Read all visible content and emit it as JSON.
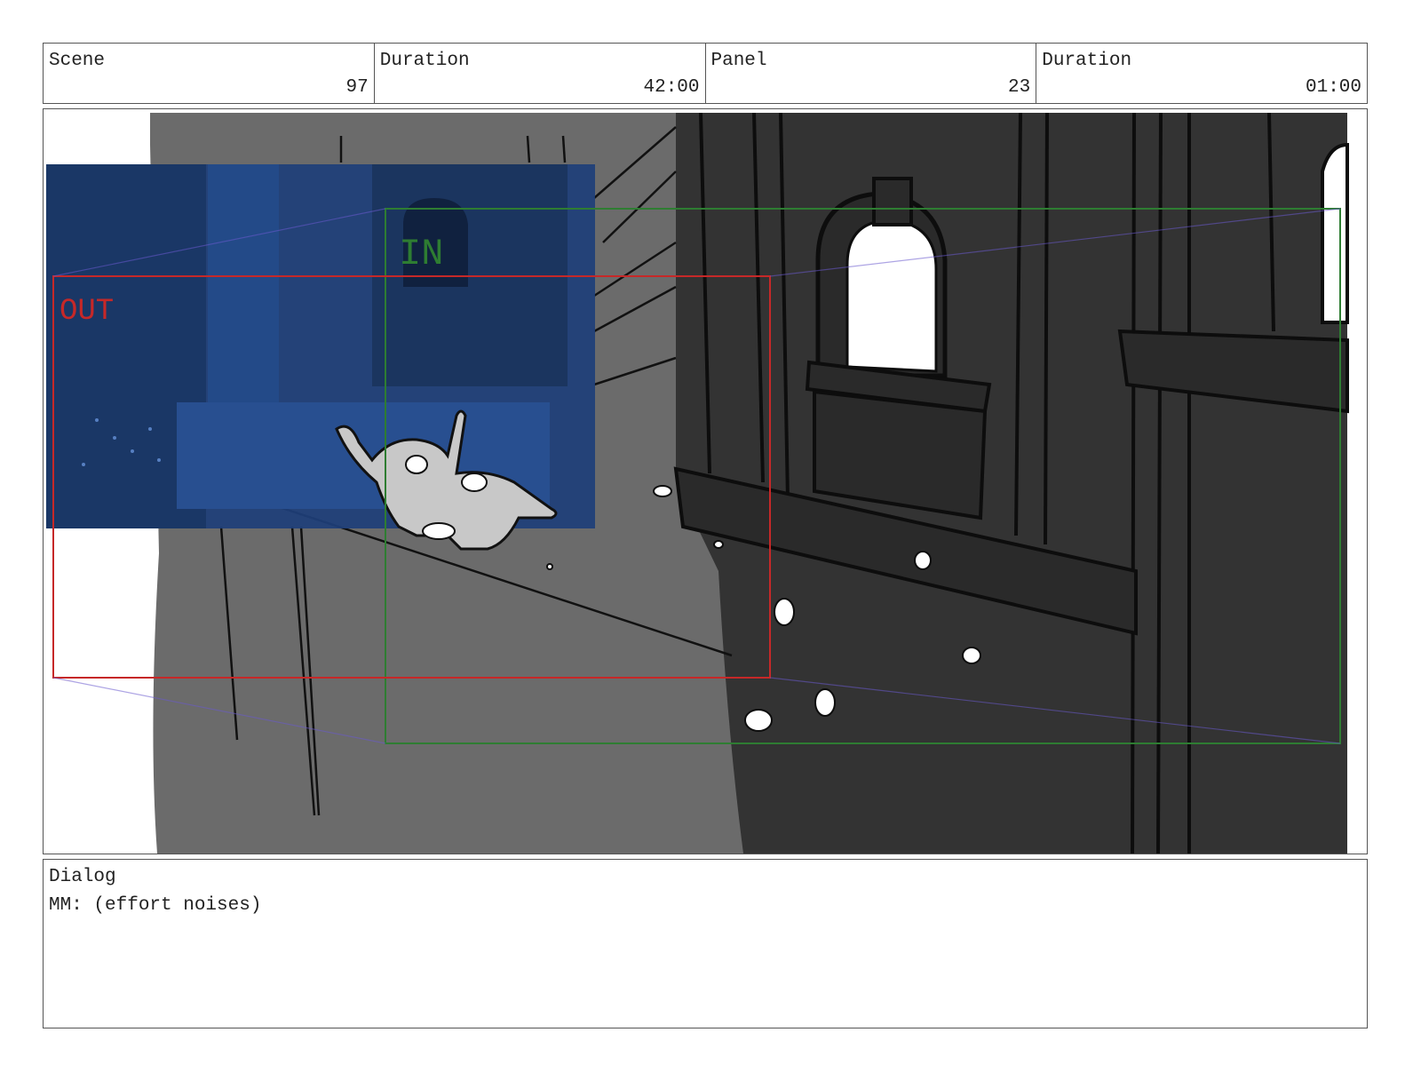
{
  "header": {
    "scene_label": "Scene",
    "scene_value": "97",
    "scene_duration_label": "Duration",
    "scene_duration_value": "42:00",
    "panel_label": "Panel",
    "panel_value": "23",
    "panel_duration_label": "Duration",
    "panel_duration_value": "01:00"
  },
  "panel": {
    "in_frame_label": "IN",
    "out_frame_label": "OUT",
    "colors": {
      "in_frame": "#2e7d32",
      "out_frame": "#c62828",
      "building_dark": "#333333",
      "wall_mid": "#6b6b6b",
      "bg_overlay": "#1e3f7a"
    }
  },
  "dialog": {
    "label": "Dialog",
    "text": "MM: (effort noises)"
  }
}
